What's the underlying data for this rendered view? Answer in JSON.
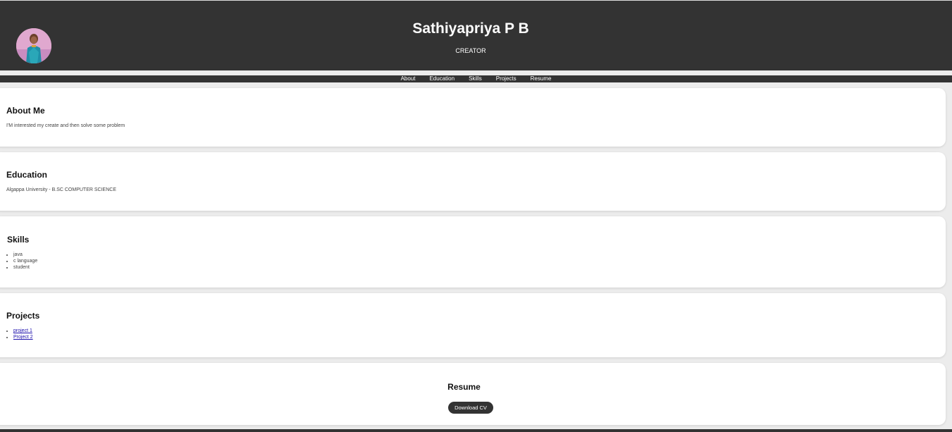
{
  "header": {
    "name": "Sathiyapriya P B",
    "role": "CREATOR",
    "avatar_icon": "profile-photo-icon"
  },
  "nav": {
    "items": [
      "About",
      "Education",
      "Skills",
      "Projects",
      "Resume"
    ]
  },
  "about": {
    "title": "About Me",
    "text": "I'M interested my create and then solve some problem"
  },
  "education": {
    "title": "Education",
    "text": "Algappa University - B.SC COMPUTER SCIENCE"
  },
  "skills": {
    "title": "Skills",
    "items": [
      "java",
      "c language",
      "student"
    ]
  },
  "projects": {
    "title": "Projects",
    "items": [
      "project 1",
      "Project 2"
    ]
  },
  "resume": {
    "title": "Resume",
    "button_label": "Download CV"
  },
  "colors": {
    "header_bg": "#333333",
    "page_bg": "#ececec",
    "card_bg": "#ffffff",
    "link": "#1a0dab"
  }
}
